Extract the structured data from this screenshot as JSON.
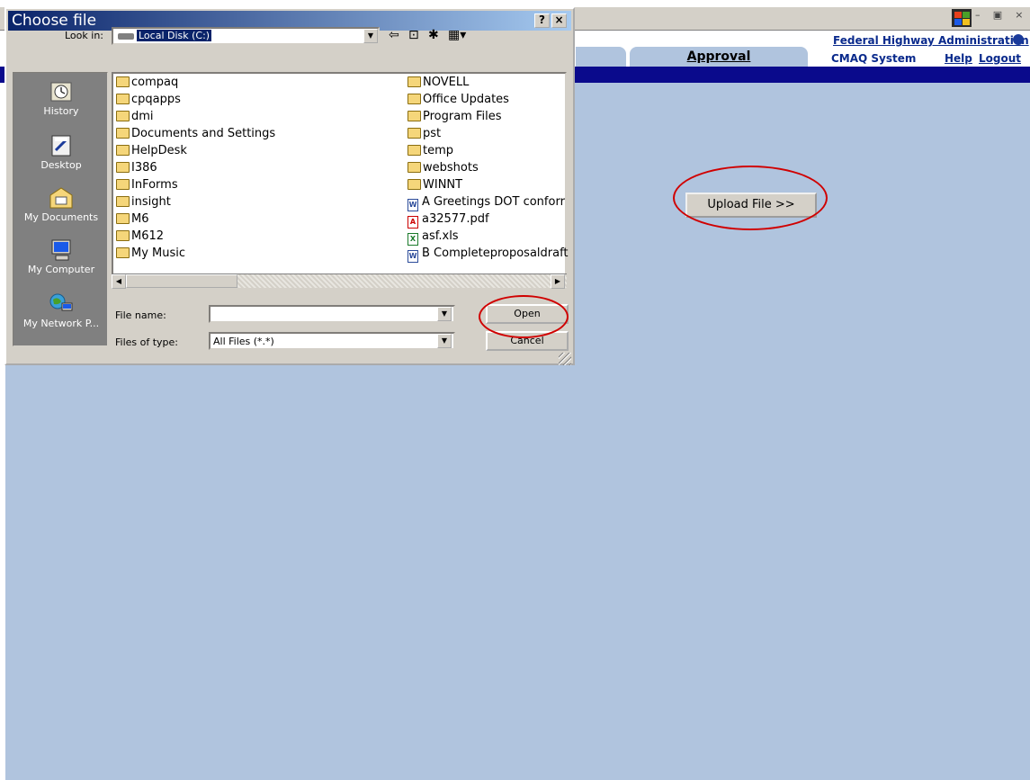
{
  "web_page": {
    "tabs": [
      {
        "label": ""
      },
      {
        "label": "Approval"
      }
    ],
    "header": {
      "agency_link": "Federal Highway Administration",
      "system_name": "CMAQ System",
      "help_link": "Help",
      "logout_link": "Logout"
    },
    "upload_button": "Upload File >>",
    "colors": {
      "content_bg": "#b0c4de",
      "navbar": "#0a0a8c",
      "link": "#0a2a8c"
    }
  },
  "dialog": {
    "title": "Choose file",
    "title_buttons": [
      "?",
      "×"
    ],
    "look_in_label": "Look in:",
    "look_in_value": "Local Disk (C:)",
    "toolbar_icons": [
      "back-icon",
      "up-folder-icon",
      "new-folder-icon",
      "view-menu-icon"
    ],
    "places": [
      {
        "label": "History",
        "icon": "history-icon"
      },
      {
        "label": "Desktop",
        "icon": "desktop-icon"
      },
      {
        "label": "My Documents",
        "icon": "my-documents-icon"
      },
      {
        "label": "My Computer",
        "icon": "my-computer-icon"
      },
      {
        "label": "My Network P...",
        "icon": "my-network-places-icon"
      }
    ],
    "files_col1": [
      {
        "name": "compaq",
        "type": "folder"
      },
      {
        "name": "cpqapps",
        "type": "folder"
      },
      {
        "name": "dmi",
        "type": "folder"
      },
      {
        "name": "Documents and Settings",
        "type": "folder"
      },
      {
        "name": "HelpDesk",
        "type": "folder"
      },
      {
        "name": "I386",
        "type": "folder"
      },
      {
        "name": "InForms",
        "type": "folder"
      },
      {
        "name": "insight",
        "type": "folder"
      },
      {
        "name": "M6",
        "type": "folder"
      },
      {
        "name": "M612",
        "type": "folder"
      },
      {
        "name": "My Music",
        "type": "folder"
      }
    ],
    "files_col2": [
      {
        "name": "NOVELL",
        "type": "folder"
      },
      {
        "name": "Office Updates",
        "type": "folder"
      },
      {
        "name": "Program Files",
        "type": "folder"
      },
      {
        "name": "pst",
        "type": "folder"
      },
      {
        "name": "temp",
        "type": "folder"
      },
      {
        "name": "webshots",
        "type": "folder"
      },
      {
        "name": "WINNT",
        "type": "folder"
      },
      {
        "name": "A Greetings DOT conforr",
        "type": "word"
      },
      {
        "name": "a32577.pdf",
        "type": "pdf"
      },
      {
        "name": "asf.xls",
        "type": "excel"
      },
      {
        "name": "B Completeproposaldraft",
        "type": "word"
      }
    ],
    "file_name_label": "File name:",
    "file_name_value": "",
    "files_of_type_label": "Files of type:",
    "files_of_type_value": "All Files (*.*)",
    "open_button": "Open",
    "cancel_button": "Cancel"
  }
}
